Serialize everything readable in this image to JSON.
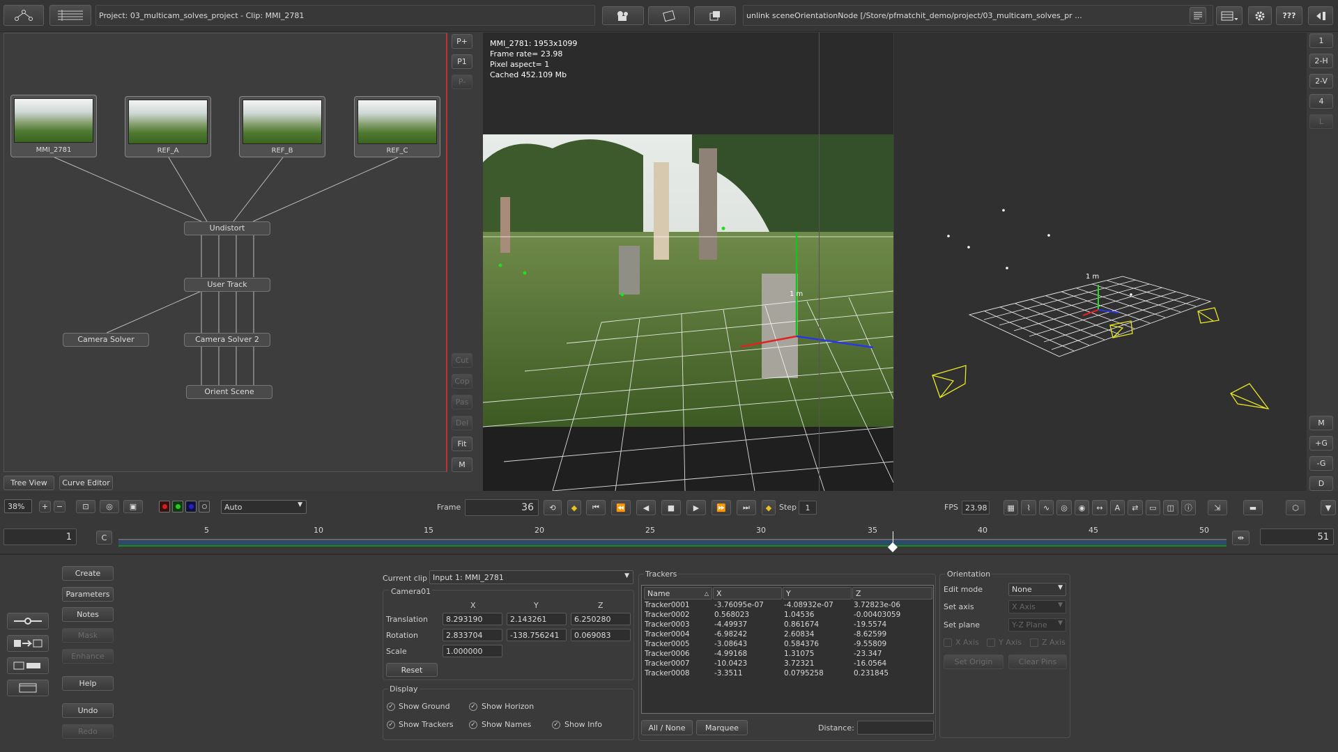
{
  "topbar": {
    "project_label": "Project: 03_multicam_solves_project - Clip: MMI_2781",
    "status_message": "unlink sceneOrientationNode [/Store/pfmatchit_demo/project/03_multicam_solves_pr ...",
    "help_label": "???"
  },
  "nodegraph": {
    "thumbnails": [
      {
        "label": "MMI_2781"
      },
      {
        "label": "REF_A"
      },
      {
        "label": "REF_B"
      },
      {
        "label": "REF_C"
      }
    ],
    "nodes": {
      "undistort": "Undistort",
      "user_track": "User Track",
      "camera_solver": "Camera Solver",
      "camera_solver2": "Camera Solver 2",
      "orient_scene": "Orient Scene"
    },
    "tabs": [
      "Tree View",
      "Curve Editor"
    ]
  },
  "side_buttons": {
    "left": [
      "P+",
      "P1",
      "P-",
      "Cut",
      "Cop",
      "Pas",
      "Del",
      "Fit",
      "M"
    ],
    "right": [
      "1",
      "2-H",
      "2-V",
      "4",
      "L",
      "M",
      "+G",
      "-G",
      "D"
    ]
  },
  "viewer": {
    "info": [
      "MMI_2781: 1953x1099",
      "Frame rate= 23.98",
      "Pixel aspect= 1",
      "Cached 452.109 Mb"
    ],
    "scale_label": "1 m",
    "scale_label_3d": "1 m"
  },
  "controls": {
    "zoom": "38%",
    "display_mode": "Auto",
    "frame_label": "Frame",
    "frame_value": "36",
    "step_label": "Step",
    "step_value": "1",
    "fps_label": "FPS",
    "fps_value": "23.98",
    "c_button": "C",
    "start_frame": "1",
    "end_frame": "51",
    "ticks": [
      "5",
      "10",
      "15",
      "20",
      "25",
      "30",
      "35",
      "40",
      "45",
      "50"
    ]
  },
  "left_buttons": [
    "Create",
    "Parameters",
    "Notes",
    "Mask",
    "Enhance",
    "Help",
    "Undo",
    "Redo"
  ],
  "params": {
    "current_clip_label": "Current clip",
    "current_clip_value": "Input 1: MMI_2781",
    "camera_group": "Camera01",
    "headers": [
      "X",
      "Y",
      "Z"
    ],
    "translation_label": "Translation",
    "translation": [
      "8.293190",
      "2.143261",
      "6.250280"
    ],
    "rotation_label": "Rotation",
    "rotation": [
      "2.833704",
      "-138.756241",
      "0.069083"
    ],
    "scale_label": "Scale",
    "scale": "1.000000",
    "reset": "Reset",
    "display_group": "Display",
    "checkboxes": [
      "Show Ground",
      "Show Horizon",
      "Show Trackers",
      "Show Names",
      "Show Info"
    ]
  },
  "trackers": {
    "title": "Trackers",
    "columns": [
      "Name",
      "X",
      "Y",
      "Z"
    ],
    "rows": [
      [
        "Tracker0001",
        "-3.76095e-07",
        "-4.08932e-07",
        "3.72823e-06"
      ],
      [
        "Tracker0002",
        "0.568023",
        "1.04536",
        "-0.00403059"
      ],
      [
        "Tracker0003",
        "-4.49937",
        "0.861674",
        "-19.5574"
      ],
      [
        "Tracker0004",
        "-6.98242",
        "2.60834",
        "-8.62599"
      ],
      [
        "Tracker0005",
        "-3.08643",
        "0.584376",
        "-9.55809"
      ],
      [
        "Tracker0006",
        "-4.99168",
        "1.31075",
        "-23.347"
      ],
      [
        "Tracker0007",
        "-10.0423",
        "3.72321",
        "-16.0564"
      ],
      [
        "Tracker0008",
        "-3.3511",
        "0.0795258",
        "0.231845"
      ]
    ],
    "all_none": "All / None",
    "marquee": "Marquee",
    "distance_label": "Distance:"
  },
  "orientation": {
    "title": "Orientation",
    "edit_mode_label": "Edit mode",
    "edit_mode_value": "None",
    "set_axis_label": "Set axis",
    "set_axis_value": "X Axis",
    "set_plane_label": "Set plane",
    "set_plane_value": "Y-Z Plane",
    "axis_checks": [
      "X Axis",
      "Y Axis",
      "Z Axis"
    ],
    "set_origin": "Set Origin",
    "clear_pins": "Clear Pins"
  },
  "colors": {
    "accent_red": "#bb3333",
    "timeline_blue": "#2d4a66",
    "playhead": "#ffffff"
  }
}
